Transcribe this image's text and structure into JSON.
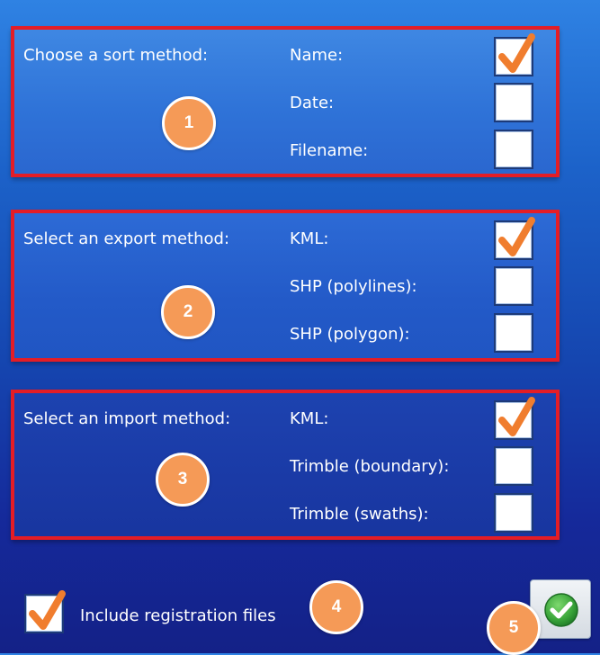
{
  "sort": {
    "label": "Choose a sort method:",
    "badge": "1",
    "options": [
      {
        "label": "Name:",
        "checked": true
      },
      {
        "label": "Date:",
        "checked": false
      },
      {
        "label": "Filename:",
        "checked": false
      }
    ]
  },
  "export": {
    "label": "Select an export method:",
    "badge": "2",
    "options": [
      {
        "label": "KML:",
        "checked": true
      },
      {
        "label": "SHP (polylines):",
        "checked": false
      },
      {
        "label": "SHP (polygon):",
        "checked": false
      }
    ]
  },
  "import": {
    "label": "Select an import method:",
    "badge": "3",
    "options": [
      {
        "label": "KML:",
        "checked": true
      },
      {
        "label": "Trimble (boundary):",
        "checked": false
      },
      {
        "label": "Trimble (swaths):",
        "checked": false
      }
    ]
  },
  "registration": {
    "label": "Include registration files",
    "checked": true,
    "badge": "4"
  },
  "confirm": {
    "badge": "5",
    "icon": "green-checkmark-icon"
  },
  "colors": {
    "highlight_border": "#e41d26",
    "check_mark": "#f07d2e",
    "badge": "#f59a57",
    "confirm_icon": "#3aa53a"
  }
}
